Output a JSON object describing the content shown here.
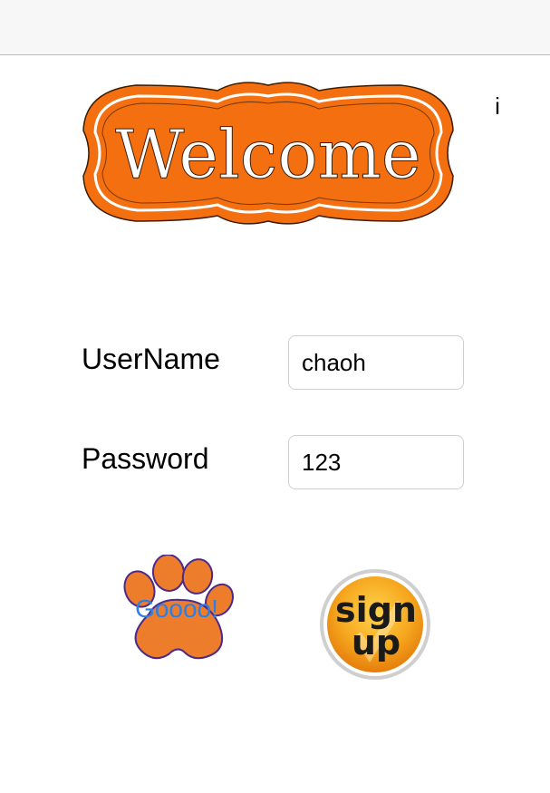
{
  "banner": {
    "text": "Welcome",
    "color": "#f36f0f"
  },
  "info": {
    "label": "i"
  },
  "form": {
    "username_label": "UserName",
    "username_value": "chaoh",
    "password_label": "Password",
    "password_value": "123"
  },
  "actions": {
    "login_label": "Goooo!",
    "login_icon": "tiger-paw-icon",
    "signup_line1": "sign",
    "signup_line2": "up",
    "signup_icon": "sign-up-badge-icon"
  },
  "colors": {
    "accent_orange": "#f36f0f",
    "paw_orange": "#ee7d2b",
    "paw_outline": "#4b2a8a",
    "login_text": "#2a7fe8",
    "signup_gold": "#f5a623"
  }
}
